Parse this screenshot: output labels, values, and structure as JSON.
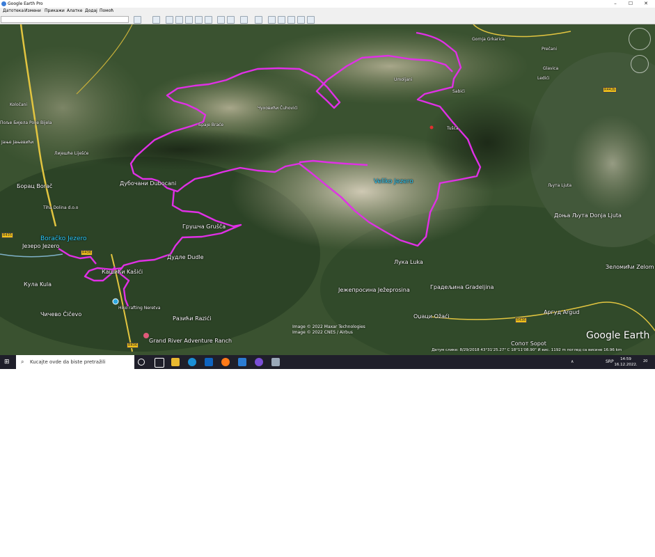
{
  "window": {
    "title": "Google Earth Pro",
    "controls": [
      "–",
      "☐",
      "✕"
    ]
  },
  "menu": [
    "Датотека",
    "Измени",
    "Прикажи",
    "Алатке",
    "Додај",
    "Помоћ"
  ],
  "map": {
    "labels": [
      {
        "text": "Velіko Jezero",
        "style": "cyan"
      },
      {
        "text": "Boračko Jezero",
        "style": "cyan"
      },
      {
        "text": "Језеро Jezero"
      },
      {
        "text": "Кула Kula"
      },
      {
        "text": "Чичево Čičevo"
      },
      {
        "text": "Борац Borač"
      },
      {
        "text": "Tiha Dolina d.o.o",
        "style": "sm"
      },
      {
        "text": "Дубочани Dubocаni"
      },
      {
        "text": "Грушча Grušča"
      },
      {
        "text": "Дудле Dudle"
      },
      {
        "text": "Кашићи Kašići"
      },
      {
        "text": "Hiko rafting Neretva",
        "style": "sm"
      },
      {
        "text": "Разићи Razići"
      },
      {
        "text": "Grand River Adventure Ranch"
      },
      {
        "text": "Лука Luka"
      },
      {
        "text": "Јежепросина Ježeprosina"
      },
      {
        "text": "Градељина Gradeljina"
      },
      {
        "text": "Оџаци Ožaći"
      },
      {
        "text": "Аргуд Argud"
      },
      {
        "text": "Зеломићи Zelom"
      },
      {
        "text": "Сопот Sopot"
      },
      {
        "text": "Доња Љута Donja Ljuta"
      },
      {
        "text": "Љута Ljuta",
        "style": "sm"
      },
      {
        "text": "Tušća",
        "style": "sm"
      },
      {
        "text": "Sabići",
        "style": "sm"
      },
      {
        "text": "Umoljani",
        "style": "sm"
      },
      {
        "text": "Браје Braće",
        "style": "sm"
      },
      {
        "text": "Чуховићи Čuhovići",
        "style": "sm"
      },
      {
        "text": "Лијешће Liješće",
        "style": "sm"
      },
      {
        "text": "Јање Јањевићи",
        "style": "sm"
      },
      {
        "text": "Поље Бијела Polje Bijela",
        "style": "sm"
      },
      {
        "text": "Gornja Grkarica",
        "style": "sm"
      },
      {
        "text": "Prečani",
        "style": "sm"
      },
      {
        "text": "Glavica",
        "style": "sm"
      },
      {
        "text": "Ledići",
        "style": "sm"
      },
      {
        "text": "Koločani",
        "style": "sm"
      }
    ],
    "roads": [
      "R435",
      "R436",
      "R436",
      "R436",
      "R442b"
    ],
    "credits": [
      "Image © 2022 Maxar Technologies",
      "Image © 2022 CNES / Airbus"
    ],
    "logo": "Google Earth",
    "status": "Датум слике: 8/29/2018     43°31'25.27\" С    18°11'08.90\" И    вис. 1192 m    поглед са висине 16.96 km",
    "track_color": "#e030e6"
  },
  "taskbar": {
    "search_placeholder": "Kucajte ovde da biste pretražili",
    "lang": "SRP",
    "time": "14:59",
    "date": "16.12.2022.",
    "notif_count": "20"
  }
}
